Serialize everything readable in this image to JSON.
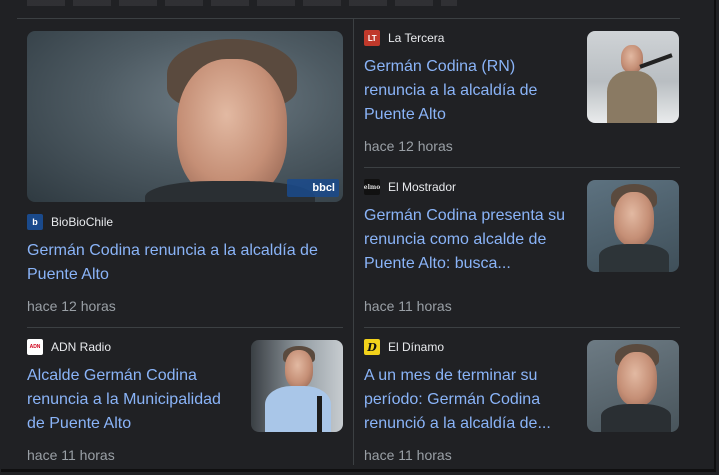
{
  "stories": [
    {
      "source": "BioBioChile",
      "logo_icon": "biobiochile-logo-icon",
      "title": "Germán Codina renuncia a la alcaldía de Puente Alto",
      "time": "hace 12 horas",
      "image_tag": "bbcl"
    },
    {
      "source": "La Tercera",
      "logo_icon": "la-tercera-logo-icon",
      "title": "Germán Codina (RN) renuncia a la alcaldía de Puente Alto",
      "time": "hace 12 horas"
    },
    {
      "source": "El Mostrador",
      "logo_icon": "el-mostrador-logo-icon",
      "title": "Germán Codina presenta su renuncia como alcalde de Puente Alto: busca...",
      "time": "hace 11 horas"
    },
    {
      "source": "ADN Radio",
      "logo_icon": "adn-radio-logo-icon",
      "title": "Alcalde Germán Codina renuncia a la Municipalidad de Puente Alto",
      "time": "hace 11 horas"
    },
    {
      "source": "El Dínamo",
      "logo_icon": "el-dinamo-logo-icon",
      "title": "A un mes de terminar su período: Germán Codina renunció a la alcaldía de...",
      "time": "hace 11 horas"
    }
  ],
  "logo_text": {
    "biobiochile": "b",
    "la_tercera": "LT",
    "el_mostrador": "elmo",
    "adn_radio": "ADN",
    "el_dinamo": "D"
  },
  "colors": {
    "background": "#202124",
    "link": "#8ab4f8",
    "source_text": "#e8eaed",
    "meta_text": "#9aa0a6",
    "divider": "#3c4043"
  }
}
